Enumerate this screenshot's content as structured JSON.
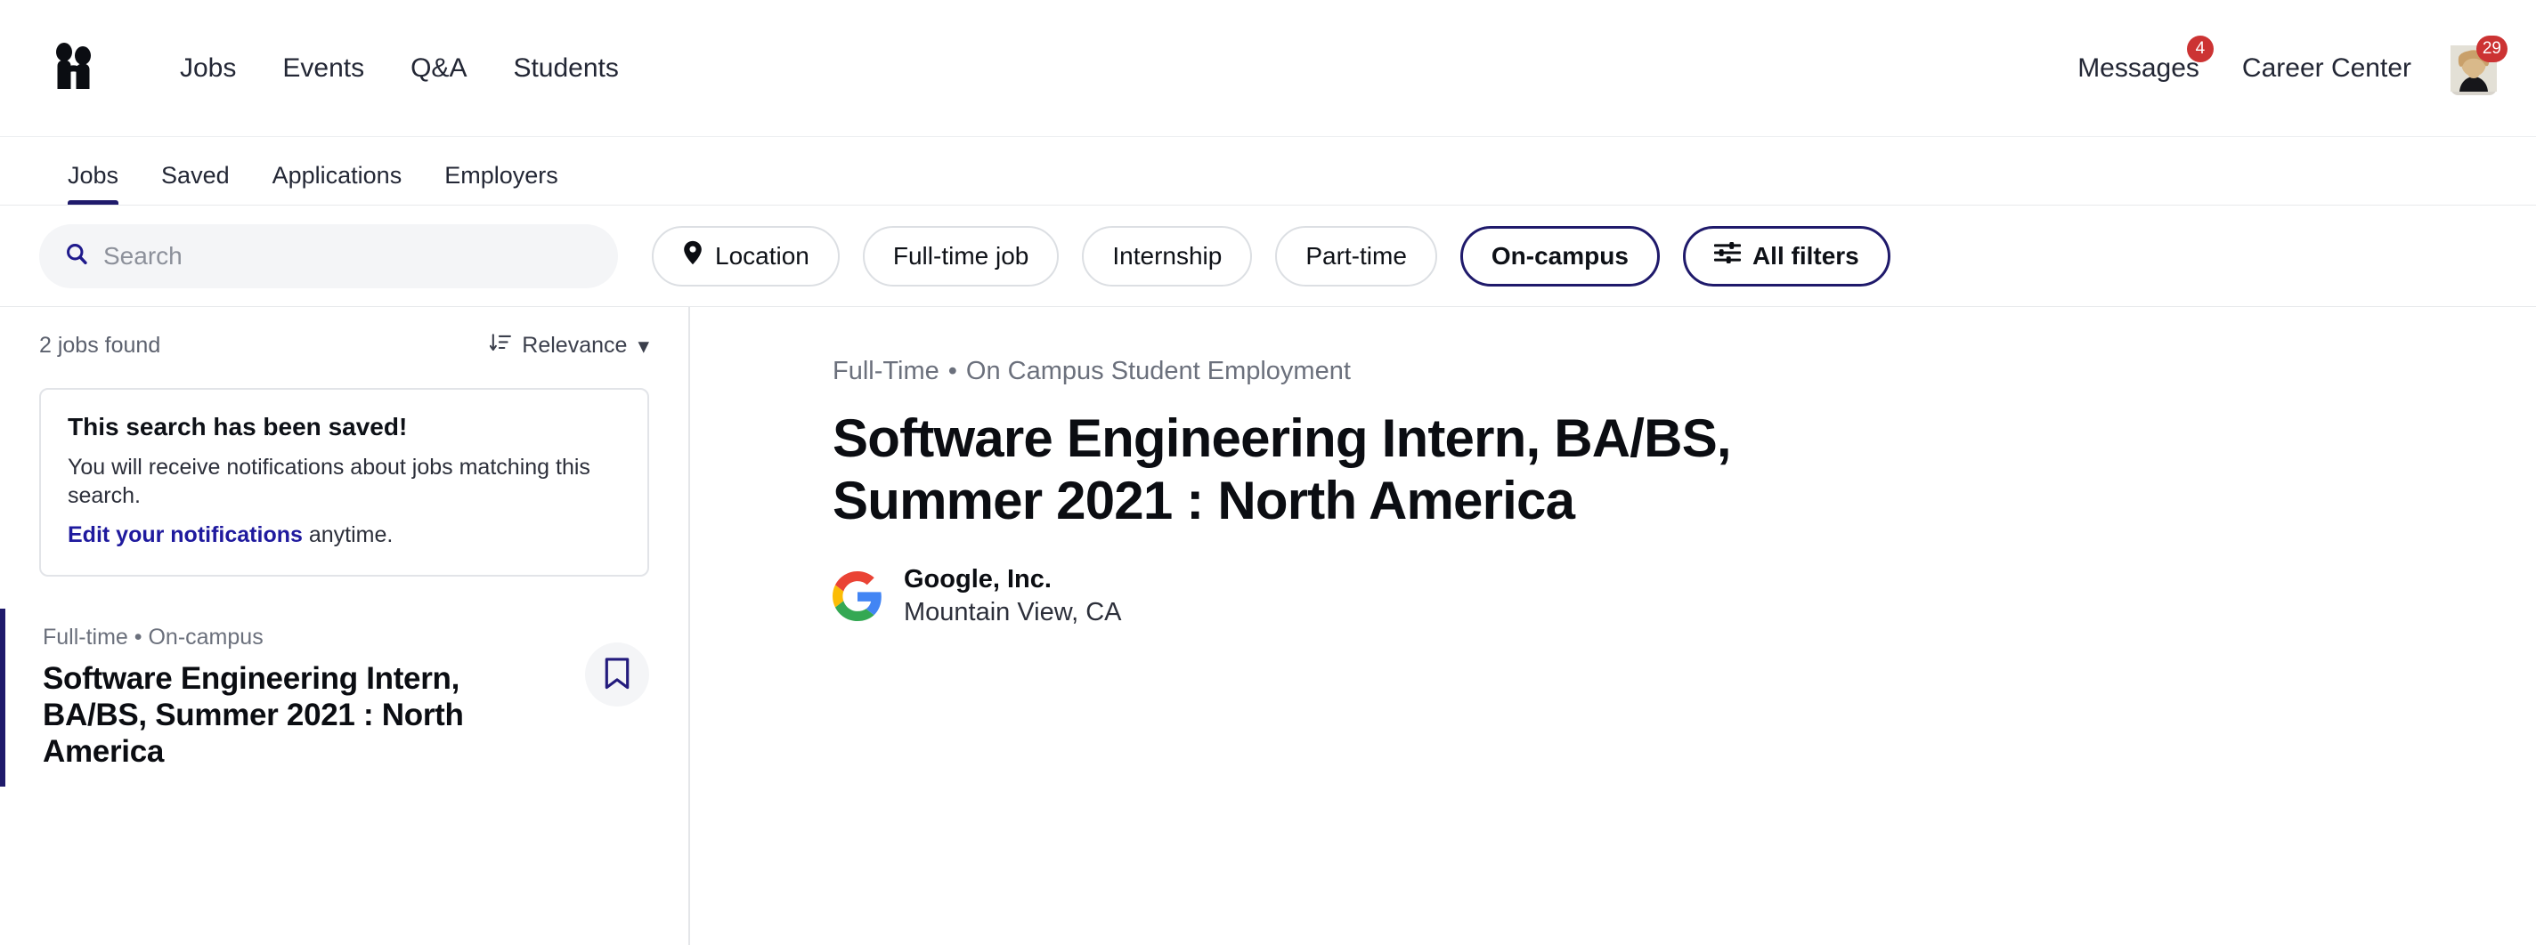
{
  "brand": {
    "logo_name": "handshake-logo",
    "navy": "#1f1a6b",
    "link_blue": "#1f1a9e",
    "badge_red": "#cc3333"
  },
  "topnav": {
    "links": [
      {
        "label": "Jobs"
      },
      {
        "label": "Events"
      },
      {
        "label": "Q&A"
      },
      {
        "label": "Students"
      }
    ],
    "messages_label": "Messages",
    "messages_badge": "4",
    "career_center_label": "Career Center",
    "avatar_badge": "29"
  },
  "subnav": {
    "tabs": [
      {
        "label": "Jobs",
        "active": true
      },
      {
        "label": "Saved",
        "active": false
      },
      {
        "label": "Applications",
        "active": false
      },
      {
        "label": "Employers",
        "active": false
      }
    ]
  },
  "filterbar": {
    "search": {
      "value": "",
      "placeholder": "Search",
      "icon": "search-icon"
    },
    "pills": [
      {
        "label": "Location",
        "icon": "map-pin-icon",
        "active": false
      },
      {
        "label": "Full-time job",
        "icon": null,
        "active": false
      },
      {
        "label": "Internship",
        "icon": null,
        "active": false
      },
      {
        "label": "Part-time",
        "icon": null,
        "active": false
      },
      {
        "label": "On-campus",
        "icon": null,
        "active": true
      },
      {
        "label": "All filters",
        "icon": "sliders-icon",
        "active": true
      }
    ]
  },
  "results": {
    "count_label": "2 jobs found",
    "sort_label": "Relevance",
    "sort_icon": "sort-descending-icon",
    "sort_caret": "▾"
  },
  "saved_search_card": {
    "title": "This search has been saved!",
    "body": "You will receive notifications about jobs matching this search.",
    "link_text": "Edit your notifications",
    "link_suffix": " anytime."
  },
  "job_list": [
    {
      "meta": "Full-time • On-campus",
      "title": "Software Engineering Intern, BA/BS, Summer 2021 : North America",
      "selected": true,
      "bookmark_icon": "bookmark-icon"
    }
  ],
  "detail": {
    "employment_type": "Full-Time",
    "separator": "•",
    "category": "On Campus Student Employment",
    "title": "Software Engineering Intern, BA/BS, Summer 2021 : North America",
    "employer_name": "Google, Inc.",
    "employer_location": "Mountain View, CA",
    "employer_logo": "google-logo"
  }
}
